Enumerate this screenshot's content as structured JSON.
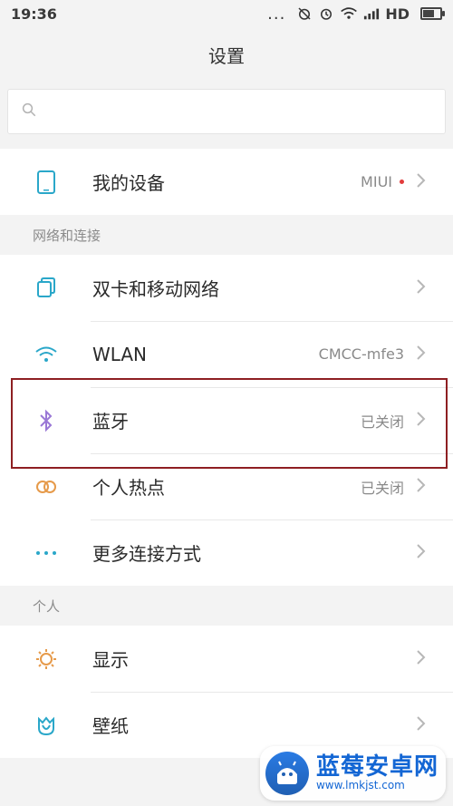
{
  "status": {
    "time": "19:36",
    "dots": "...",
    "network_label": "HD"
  },
  "header": {
    "title": "设置"
  },
  "search": {
    "placeholder": ""
  },
  "groups": [
    {
      "title": "",
      "items": [
        {
          "label": "我的设备",
          "value": "MIUI",
          "has_dot": true,
          "icon": "phone-icon"
        }
      ]
    },
    {
      "title": "网络和连接",
      "items": [
        {
          "label": "双卡和移动网络",
          "value": "",
          "icon": "dual-sim-icon"
        },
        {
          "label": "WLAN",
          "value": "CMCC-mfe3",
          "icon": "wifi-icon"
        },
        {
          "label": "蓝牙",
          "value": "已关闭",
          "icon": "bluetooth-icon"
        },
        {
          "label": "个人热点",
          "value": "已关闭",
          "icon": "hotspot-icon"
        },
        {
          "label": "更多连接方式",
          "value": "",
          "icon": "more-dots-icon"
        }
      ]
    },
    {
      "title": "个人",
      "items": [
        {
          "label": "显示",
          "value": "",
          "icon": "sun-icon"
        },
        {
          "label": "壁纸",
          "value": "",
          "icon": "wallpaper-icon"
        }
      ]
    }
  ],
  "watermark": {
    "title": "蓝莓安卓网",
    "url": "www.lmkjst.com"
  },
  "colors": {
    "accent": "#2aa7c9",
    "highlight_border": "#8e1f22",
    "dot": "#e23b3b"
  }
}
